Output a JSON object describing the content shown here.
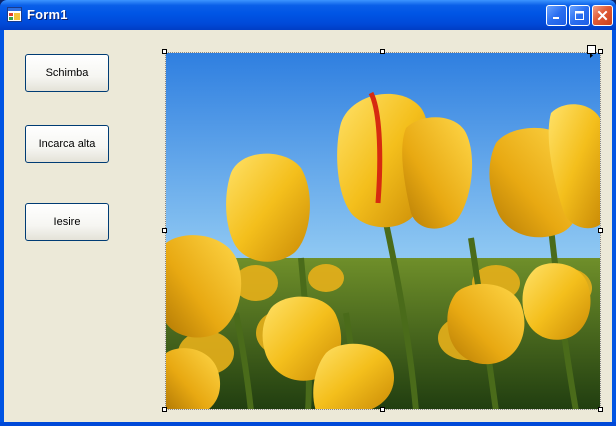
{
  "window": {
    "title": "Form1"
  },
  "buttons": {
    "schimba": "Schimba",
    "incarca_alta": "Incarca alta",
    "iesire": "Iesire"
  },
  "icons": {
    "app": "form-icon",
    "minimize": "minimize-icon",
    "maximize": "maximize-icon",
    "close": "close-icon",
    "smart_tag": "smart-tag-arrow-icon"
  },
  "colors": {
    "titlebar": "#0055e5",
    "client": "#ece9d8",
    "close_button": "#e05a34",
    "button_border": "#003c74"
  }
}
